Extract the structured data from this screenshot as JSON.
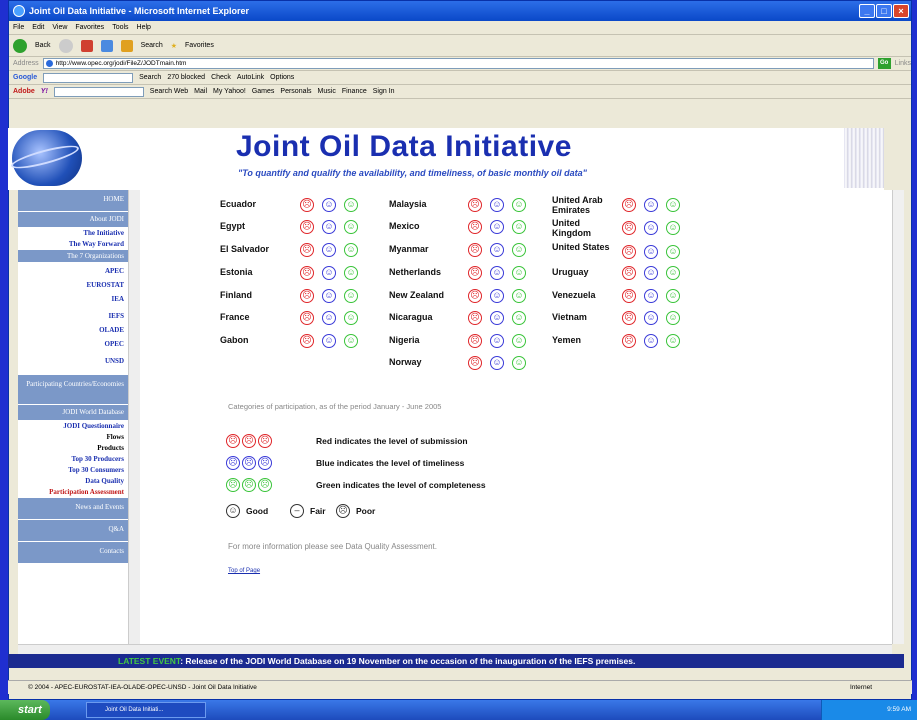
{
  "window": {
    "title": "Joint Oil Data Initiative - Microsoft Internet Explorer"
  },
  "menubar": [
    "File",
    "Edit",
    "View",
    "Favorites",
    "Tools",
    "Help"
  ],
  "toolbar": {
    "back": "Back",
    "search": "Search",
    "favorites": "Favorites"
  },
  "address": {
    "label": "Address",
    "url": "http://www.opec.org/jodi/FileZ/JODTmain.htm",
    "go": "Go",
    "links": "Links"
  },
  "google_bar": {
    "brand": "Google",
    "search": "Search",
    "blocked": "270 blocked",
    "check": "Check",
    "autolink": "AutoLink",
    "options": "Options"
  },
  "yahoo_bar": {
    "adobe": "Adobe",
    "search_web": "Search Web",
    "mail": "Mail",
    "my_yahoo": "My Yahoo!",
    "games": "Games",
    "personals": "Personals",
    "music": "Music",
    "finance": "Finance",
    "sign_in": "Sign In"
  },
  "banner": {
    "title": "Joint Oil Data Initiative",
    "subtitle": "\"To quantify and qualify the availability, and timeliness, of basic monthly oil data\""
  },
  "sidebar": {
    "home": "HOME",
    "about": "About JODI",
    "initiative": "The Initiative",
    "way_forward": "The Way Forward",
    "orgs": "The 7 Organizations",
    "org_items": [
      "APEC",
      "EUROSTAT",
      "IEA",
      "IEFS",
      "OLADE",
      "OPEC",
      "UNSD"
    ],
    "participating": "Participating Countries/Economies",
    "world_db": "JODI World Database",
    "db_items": [
      "JODI Questionnaire",
      "Flows",
      "Products",
      "Top 30 Producers",
      "Top 30 Consumers",
      "Data Quality",
      "Participation Assessment"
    ],
    "news": "News and Events",
    "qa": "Q&A",
    "contacts": "Contacts"
  },
  "countries": {
    "col1": [
      "Ecuador",
      "Egypt",
      "El Salvador",
      "Estonia",
      "Finland",
      "France",
      "Gabon"
    ],
    "col2": [
      "Malaysia",
      "Mexico",
      "Myanmar",
      "Netherlands",
      "New Zealand",
      "Nicaragua",
      "Nigeria",
      "Norway"
    ],
    "col3": [
      "United Arab Emirates",
      "United Kingdom",
      "United States",
      "Uruguay",
      "Venezuela",
      "Vietnam",
      "Yemen"
    ]
  },
  "legend": {
    "categories": "Categories of participation, as of the period January - June 2005",
    "red": "Red indicates the level of submission",
    "blue": "Blue indicates the level of timeliness",
    "green": "Green indicates the level of completeness",
    "good": "Good",
    "fair": "Fair",
    "poor": "Poor"
  },
  "more_info": "For more information please see Data Quality Assessment.",
  "top_of_page": "Top of Page",
  "ticker": {
    "label": "LATEST EVENT",
    "text": ": Release of the JODI World Database on 19 November on the occasion of the inauguration of the IEFS premises."
  },
  "status": {
    "text": "© 2004 - APEC-EUROSTAT-IEA-OLADE-OPEC-UNSD - Joint Oil Data Initiative",
    "zone": "Internet"
  },
  "taskbar": {
    "start": "start",
    "item": "Joint Oil Data Initiati...",
    "time": "9:59 AM"
  },
  "colors": {
    "red": "#e0262a",
    "blue": "#3a3ad8",
    "green": "#3ac43a",
    "title_blue": "#1a2fb0"
  }
}
